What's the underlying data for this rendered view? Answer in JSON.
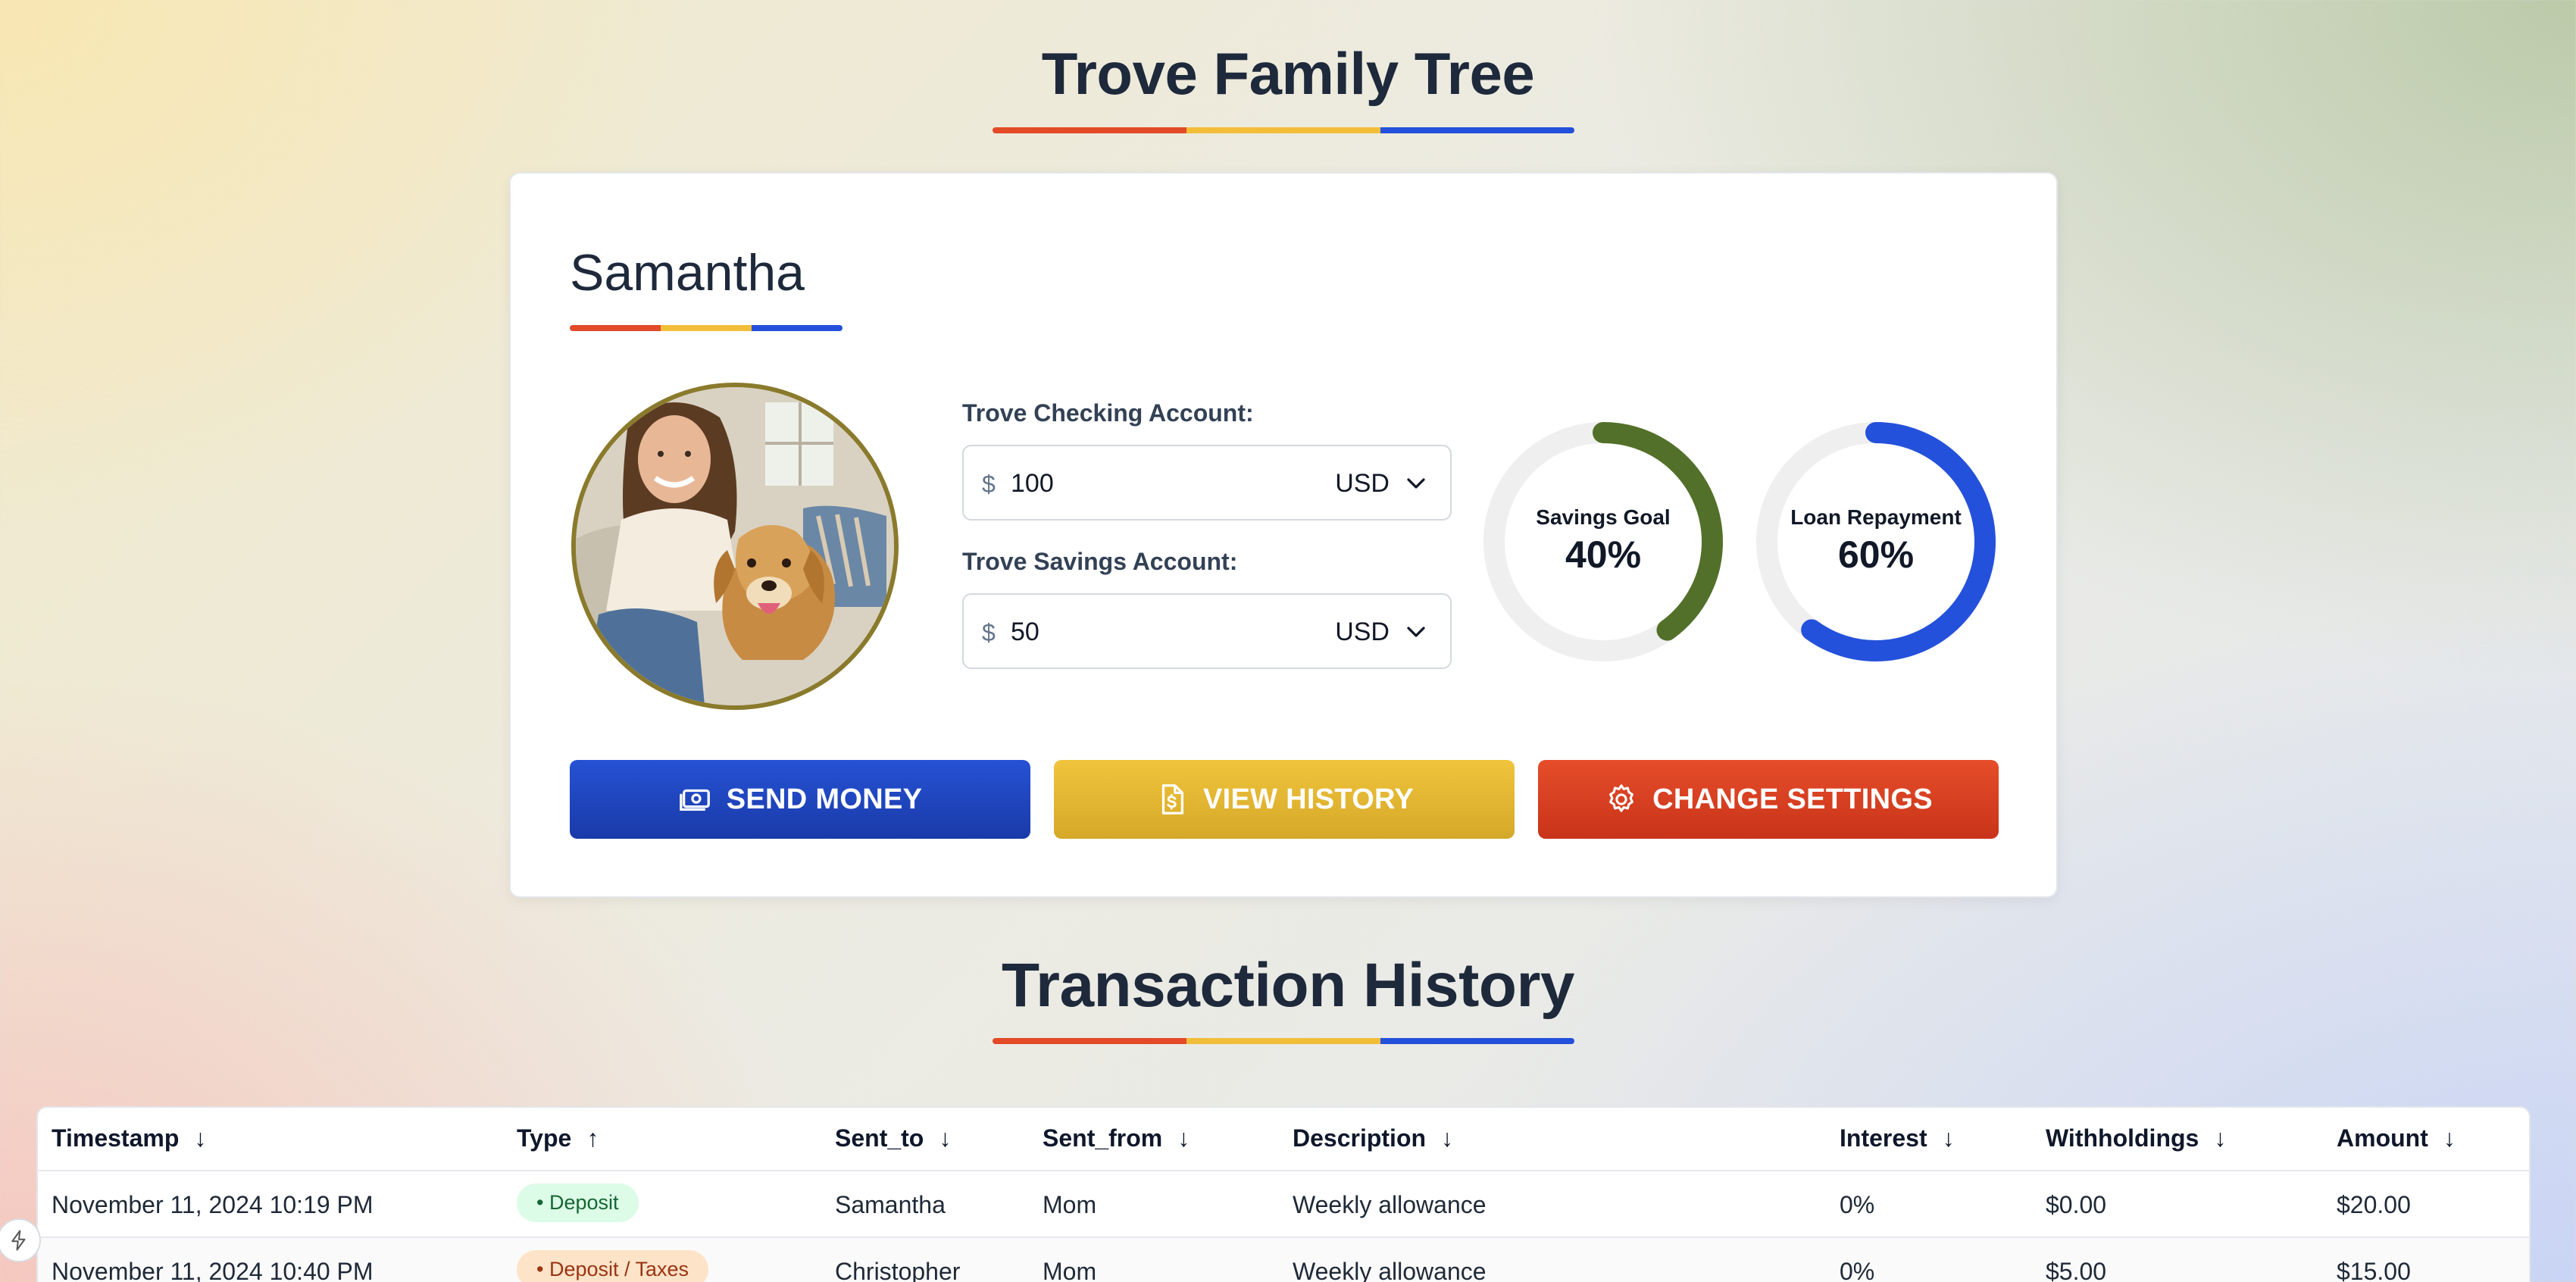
{
  "header": {
    "title": "Trove Family Tree"
  },
  "member": {
    "name": "Samantha",
    "checking": {
      "label": "Trove Checking Account:",
      "symbol": "$",
      "amount": "100",
      "currency": "USD"
    },
    "savings": {
      "label": "Trove Savings Account:",
      "symbol": "$",
      "amount": "50",
      "currency": "USD"
    },
    "goals": [
      {
        "label": "Savings Goal",
        "value": "40%",
        "percent": 40,
        "color": "#527029"
      },
      {
        "label": "Loan Repayment",
        "value": "60%",
        "percent": 60,
        "color": "#2451db"
      }
    ]
  },
  "actions": {
    "send": "SEND MONEY",
    "history": "VIEW HISTORY",
    "settings": "CHANGE SETTINGS"
  },
  "transactions": {
    "title": "Transaction History",
    "columns": [
      {
        "label": "Timestamp",
        "sort": "↓"
      },
      {
        "label": "Type",
        "sort": "↑"
      },
      {
        "label": "Sent_to",
        "sort": "↓"
      },
      {
        "label": "Sent_from",
        "sort": "↓"
      },
      {
        "label": "Description",
        "sort": "↓"
      },
      {
        "label": "Interest",
        "sort": "↓"
      },
      {
        "label": "Withholdings",
        "sort": "↓"
      },
      {
        "label": "Amount",
        "sort": "↓"
      }
    ],
    "rows": [
      {
        "timestamp": "November 11, 2024 10:19 PM",
        "type": "• Deposit",
        "sent_to": "Samantha",
        "sent_from": "Mom",
        "description": "Weekly allowance",
        "interest": "0%",
        "withholdings": "$0.00",
        "amount": "$20.00"
      },
      {
        "timestamp": "November 11, 2024 10:40 PM",
        "type": "• Deposit / Taxes",
        "sent_to": "Christopher",
        "sent_from": "Mom",
        "description": "Weekly allowance",
        "interest": "0%",
        "withholdings": "$5.00",
        "amount": "$15.00"
      }
    ]
  },
  "colors": {
    "red": "#e34a27",
    "yellow": "#f2be3a",
    "blue": "#2451db"
  }
}
